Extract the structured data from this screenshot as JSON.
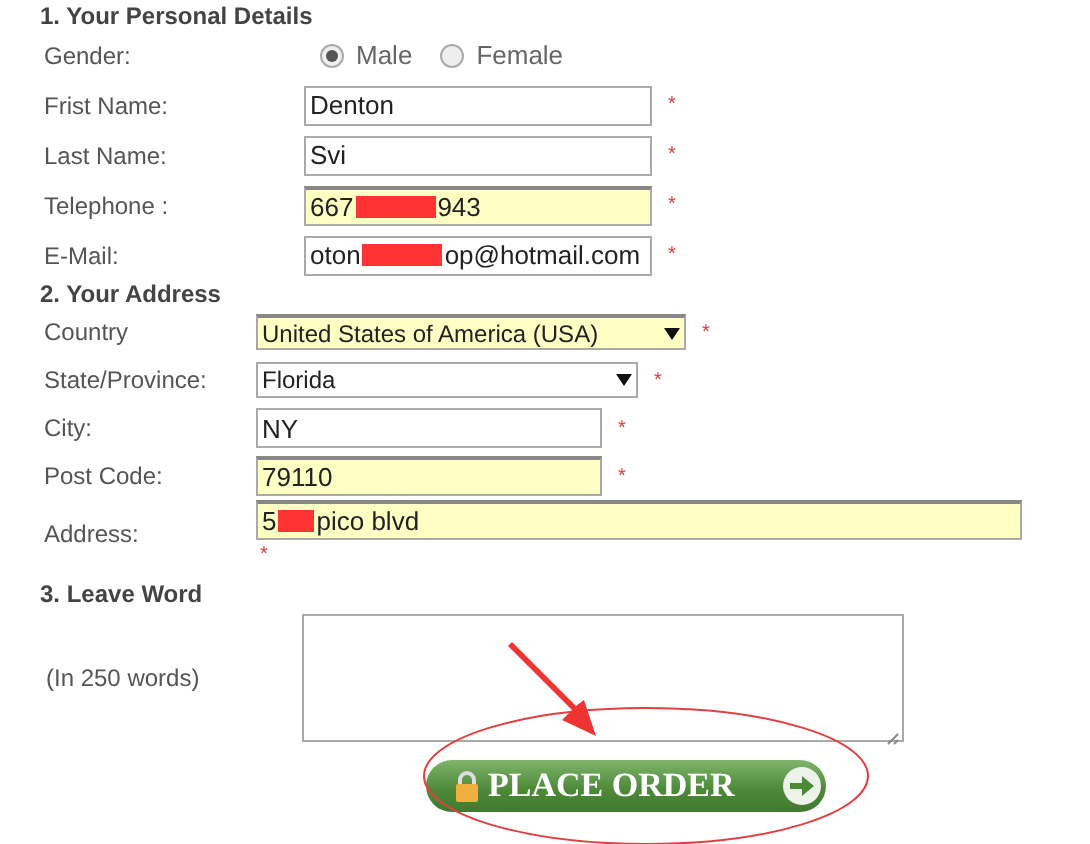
{
  "sections": [
    {
      "title": "1. Your Personal Details",
      "kind": "personal",
      "rows": [
        {
          "kind": "radio",
          "label": "Gender:",
          "options": [
            {
              "label": "Male",
              "selected": true
            },
            {
              "label": "Female",
              "selected": false
            }
          ]
        },
        {
          "kind": "text",
          "label": "Frist Name:",
          "value": "Denton",
          "highlighted": false,
          "required_mark": "*"
        },
        {
          "kind": "text",
          "label": "Last Name:",
          "value": "Svi",
          "highlighted": false,
          "required_mark": "*"
        },
        {
          "kind": "redacted",
          "label": "Telephone :",
          "value_before": "667",
          "value_after": "943",
          "highlighted": true,
          "required_mark": "*"
        },
        {
          "kind": "redacted",
          "label": "E-Mail:",
          "value_before": "oton",
          "value_after": "op@hotmail.com",
          "highlighted": false,
          "required_mark": "*"
        }
      ]
    },
    {
      "title": "2. Your Address",
      "kind": "address",
      "rows": [
        {
          "kind": "select",
          "label": "Country",
          "value": "United States of America (USA)",
          "highlighted": true,
          "required_mark": "*"
        },
        {
          "kind": "select",
          "label": "State/Province:",
          "value": "Florida",
          "highlighted": false,
          "required_mark": "*"
        },
        {
          "kind": "text",
          "label": "City:",
          "value": "NY",
          "highlighted": false,
          "required_mark": "*"
        },
        {
          "kind": "text",
          "label": "Post Code:",
          "value": "79110",
          "highlighted": true,
          "required_mark": "*"
        },
        {
          "kind": "address",
          "label": "Address:",
          "value_before": "5",
          "value_after": "pico blvd",
          "highlighted": true,
          "required_mark": "*"
        }
      ]
    },
    {
      "title": "3. Leave Word",
      "kind": "message",
      "rows": [
        {
          "kind": "textarea",
          "label": "(In 250 words)"
        }
      ]
    }
  ],
  "submit": {
    "label": "PLACE ORDER"
  }
}
